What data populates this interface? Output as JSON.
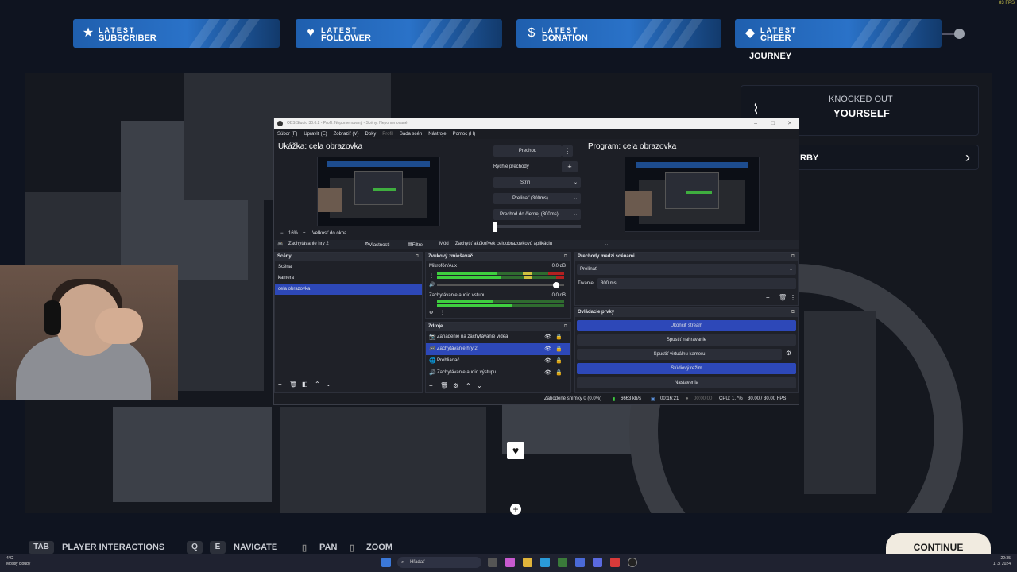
{
  "hud": {
    "alerts": [
      {
        "top": "LATEST",
        "bottom": "SUBSCRIBER",
        "icon": "star-icon"
      },
      {
        "top": "LATEST",
        "bottom": "FOLLOWER",
        "icon": "heart-icon"
      },
      {
        "top": "LATEST",
        "bottom": "DONATION",
        "icon": "dollar-icon"
      },
      {
        "top": "LATEST",
        "bottom": "CHEER",
        "icon": "diamond-icon"
      }
    ],
    "journey_label": "JOURNEY",
    "fps": "83 FPS",
    "knocked_out": {
      "line1": "KNOCKED OUT",
      "line2": "YOURSELF"
    },
    "nearby_fragment": "RBY"
  },
  "obs": {
    "title": "OBS Studio 30.0.2 - Profil: Nepomenovaný - Scény: Nepomenované",
    "menu": [
      "Súbor (F)",
      "Upraviť (E)",
      "Zobraziť (V)",
      "Doky",
      "Profil",
      "Sada scén",
      "Nástroje",
      "Pomoc (H)"
    ],
    "preview_label": "Ukážka: cela obrazovka",
    "program_label": "Program: cela obrazovka",
    "transition_btn": "Prechod",
    "quick_transitions": "Rýchle prechody",
    "cut": "Strih",
    "fade": "Prelínať (300ms)",
    "fade_black": "Prechod do čiernej (300ms)",
    "zoom": "16%",
    "zoom_mode": "Veľkosť do okna",
    "source_bar": {
      "selected_source": "Zachytávanie hry 2",
      "properties": "Vlastnosti",
      "filters": "Filtre",
      "mode_label": "Mód",
      "mode_value": "Zachytiť akúkoľvek celoobrazovkovú aplikáciu"
    },
    "scenes": {
      "title": "Scény",
      "items": [
        "Scéna",
        "kamera",
        "cela obrazovka"
      ]
    },
    "mixer": {
      "title": "Zvukový zmiešavač",
      "ch1_name": "Mikrofón/Aux",
      "ch1_db": "0.0 dB",
      "ch2_name": "Zachytávanie audio vstupu",
      "ch2_db": "0.0 dB"
    },
    "sources": {
      "title": "Zdroje",
      "items": [
        "Zariadenie na zachytávanie videa",
        "Zachytávanie hry 2",
        "Prehliadač",
        "Zachytávanie audio výstupu"
      ]
    },
    "transitions_dock": {
      "title": "Prechody medzi scénami",
      "value": "Prelínať",
      "duration_label": "Trvanie",
      "duration_value": "300 ms"
    },
    "controls": {
      "title": "Ovládacie prvky",
      "stop_stream": "Ukončiť stream",
      "start_record": "Spustiť nahrávanie",
      "start_vcam": "Spustiť virtuálnu kameru",
      "studio_mode": "Štúdiový režim",
      "settings": "Nastavenia"
    },
    "status": {
      "dropped": "Zahodené snímky 0 (0.0%)",
      "kbps": "6663 kb/s",
      "stream_time": "00:16:21",
      "rec_time": "00:00:00",
      "cpu": "CPU: 1.7%",
      "fps": "30.00 / 30.00 FPS"
    }
  },
  "hints": {
    "tab_key": "TAB",
    "player_interactions": "PLAYER INTERACTIONS",
    "q_key": "Q",
    "e_key": "E",
    "navigate": "NAVIGATE",
    "pan": "PAN",
    "zoom": "ZOOM",
    "continue": "CONTINUE"
  },
  "taskbar": {
    "temp": "4°C",
    "weather": "Mostly cloudy",
    "search": "Hľadať",
    "time": "22:35",
    "date": "1. 3. 2024"
  }
}
